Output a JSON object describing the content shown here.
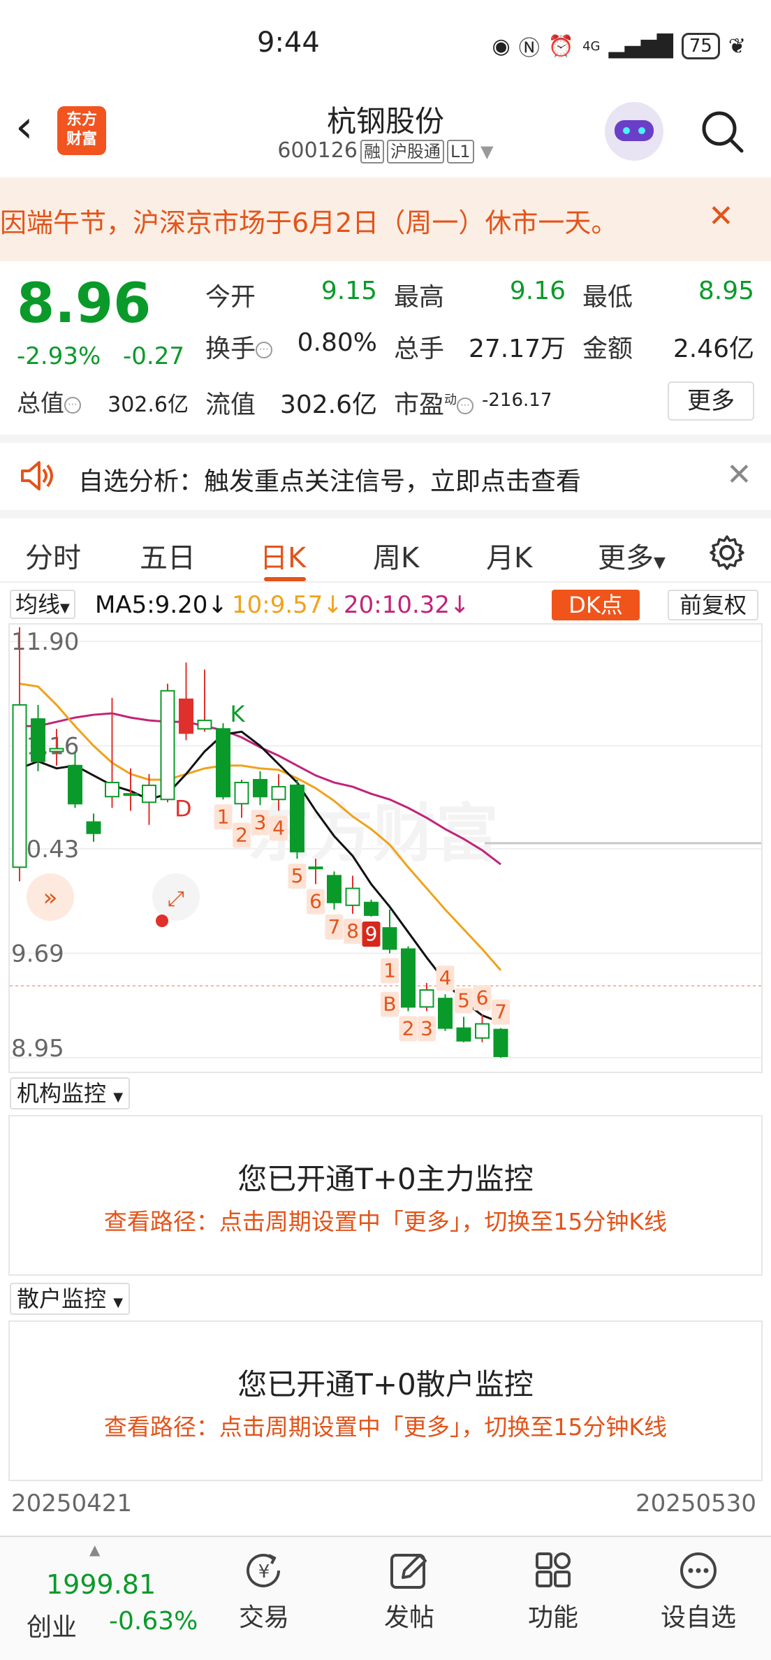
{
  "status_bar": {
    "time": "9:44",
    "battery": "75",
    "network": "4G"
  },
  "header": {
    "logo_line1": "东方",
    "logo_line2": "财富",
    "stock_name": "杭钢股份",
    "stock_code": "600126",
    "tags": [
      "融",
      "沪股通",
      "L1"
    ]
  },
  "notice": {
    "text": "因端午节，沪深京市场于6月2日（周一）休市一天。"
  },
  "quote": {
    "price": "8.96",
    "change_pct": "-2.93%",
    "change_amt": "-0.27",
    "open_label": "今开",
    "open": "9.15",
    "high_label": "最高",
    "high": "9.16",
    "low_label": "最低",
    "low": "8.95",
    "turnover_label": "换手",
    "turnover": "0.80%",
    "volume_label": "总手",
    "volume": "27.17万",
    "amount_label": "金额",
    "amount": "2.46亿",
    "mcap_label": "总值",
    "mcap": "302.6亿",
    "float_label": "流值",
    "float_cap": "302.6亿",
    "pe_label": "市盈",
    "pe_sup": "动",
    "pe": "-216.17",
    "more_label": "更多"
  },
  "analysis": {
    "text": "自选分析：触发重点关注信号，立即点击查看"
  },
  "tabs": [
    "分时",
    "五日",
    "日K",
    "周K",
    "月K",
    "更多"
  ],
  "active_tab": "日K",
  "chart_header": {
    "ma_select": "均线",
    "ma5": "MA5:9.20",
    "ma10": "10:9.57",
    "ma20": "20:10.32",
    "dk": "DK点",
    "adjust": "前复权"
  },
  "colors": {
    "up": "#e0302b",
    "down": "#0a9a2a",
    "accent": "#e2541a",
    "ma5": "#111111",
    "ma10": "#f0a21a",
    "ma20": "#c0247a"
  },
  "chart_data": {
    "type": "candlestick",
    "y_ticks": [
      "11.90",
      "11.16",
      "10.43",
      "9.69",
      "8.95"
    ],
    "ylim": [
      8.95,
      11.9
    ],
    "date_start": "20250421",
    "date_end": "20250530",
    "candles": [
      {
        "o": 10.3,
        "c": 11.45,
        "h": 12.0,
        "l": 10.2
      },
      {
        "o": 11.35,
        "c": 11.05,
        "h": 11.45,
        "l": 10.98
      },
      {
        "o": 11.12,
        "c": 11.14,
        "h": 11.28,
        "l": 11.02
      },
      {
        "o": 11.02,
        "c": 10.75,
        "h": 11.12,
        "l": 10.72
      },
      {
        "o": 10.62,
        "c": 10.54,
        "h": 10.68,
        "l": 10.48
      },
      {
        "o": 10.8,
        "c": 10.9,
        "h": 11.5,
        "l": 10.72
      },
      {
        "o": 10.82,
        "c": 10.82,
        "h": 11.0,
        "l": 10.7
      },
      {
        "o": 10.76,
        "c": 10.88,
        "h": 10.96,
        "l": 10.6
      },
      {
        "o": 10.78,
        "c": 11.55,
        "h": 11.6,
        "l": 10.76
      },
      {
        "o": 11.25,
        "c": 11.49,
        "h": 11.75,
        "l": 11.2
      },
      {
        "o": 11.28,
        "c": 11.34,
        "h": 11.7,
        "l": 11.26
      },
      {
        "o": 11.28,
        "c": 10.8,
        "h": 11.32,
        "l": 10.78
      },
      {
        "o": 10.75,
        "c": 10.9,
        "h": 10.92,
        "l": 10.65
      },
      {
        "o": 10.92,
        "c": 10.8,
        "h": 10.98,
        "l": 10.74
      },
      {
        "o": 10.78,
        "c": 10.87,
        "h": 10.96,
        "l": 10.7
      },
      {
        "o": 10.88,
        "c": 10.41,
        "h": 10.92,
        "l": 10.36
      },
      {
        "o": 10.3,
        "c": 10.3,
        "h": 10.36,
        "l": 10.18
      },
      {
        "o": 10.24,
        "c": 10.05,
        "h": 10.27,
        "l": 10.0
      },
      {
        "o": 10.03,
        "c": 10.15,
        "h": 10.24,
        "l": 9.97
      },
      {
        "o": 10.05,
        "c": 9.96,
        "h": 10.07,
        "l": 9.95
      },
      {
        "o": 9.87,
        "c": 9.72,
        "h": 10.0,
        "l": 9.69
      },
      {
        "o": 9.72,
        "c": 9.31,
        "h": 9.74,
        "l": 9.28
      },
      {
        "o": 9.31,
        "c": 9.43,
        "h": 9.48,
        "l": 9.28
      },
      {
        "o": 9.37,
        "c": 9.16,
        "h": 9.4,
        "l": 9.14
      },
      {
        "o": 9.16,
        "c": 9.07,
        "h": 9.24,
        "l": 9.06
      },
      {
        "o": 9.09,
        "c": 9.19,
        "h": 9.26,
        "l": 9.06
      },
      {
        "o": 9.15,
        "c": 8.96,
        "h": 9.16,
        "l": 8.95
      }
    ],
    "ma5": [
      11.0,
      11.05,
      11.0,
      11.02,
      10.95,
      10.88,
      10.84,
      10.78,
      10.82,
      10.96,
      11.12,
      11.24,
      11.26,
      11.16,
      11.03,
      10.9,
      10.7,
      10.52,
      10.38,
      10.18,
      10.02,
      9.84,
      9.66,
      9.49,
      9.35,
      9.25,
      9.2
    ],
    "ma10": [
      11.6,
      11.58,
      11.45,
      11.3,
      11.16,
      11.04,
      10.96,
      10.92,
      10.92,
      10.96,
      11.0,
      11.02,
      11.02,
      11.0,
      10.99,
      10.93,
      10.86,
      10.77,
      10.66,
      10.57,
      10.46,
      10.3,
      10.15,
      10.0,
      9.86,
      9.72,
      9.57
    ],
    "ma20": [
      11.3,
      11.3,
      11.33,
      11.36,
      11.38,
      11.39,
      11.36,
      11.34,
      11.33,
      11.33,
      11.3,
      11.27,
      11.22,
      11.15,
      11.09,
      11.02,
      10.95,
      10.9,
      10.87,
      10.82,
      10.78,
      10.72,
      10.65,
      10.57,
      10.5,
      10.42,
      10.32
    ],
    "signals": [
      {
        "i": 8,
        "text": "D",
        "pos": "below",
        "color": "#e0302b"
      },
      {
        "i": 11,
        "text": "K",
        "pos": "above",
        "color": "#0a9a2a"
      },
      {
        "i": 11,
        "text": "1",
        "pos": "below",
        "color": "#e2541a"
      },
      {
        "i": 12,
        "text": "2",
        "pos": "below",
        "color": "#e2541a"
      },
      {
        "i": 13,
        "text": "3",
        "pos": "below",
        "color": "#e2541a"
      },
      {
        "i": 14,
        "text": "4",
        "pos": "below",
        "color": "#e2541a"
      },
      {
        "i": 15,
        "text": "5",
        "pos": "below",
        "color": "#e2541a"
      },
      {
        "i": 16,
        "text": "6",
        "pos": "below",
        "color": "#e2541a"
      },
      {
        "i": 17,
        "text": "7",
        "pos": "below",
        "color": "#e2541a"
      },
      {
        "i": 18,
        "text": "8",
        "pos": "below",
        "color": "#e2541a"
      },
      {
        "i": 19,
        "text": "9",
        "pos": "below",
        "color": "#d8271c"
      },
      {
        "i": 20,
        "text": "1",
        "pos": "below",
        "color": "#e2541a"
      },
      {
        "i": 20,
        "text": "B",
        "pos": "below",
        "color": "#e2541a"
      },
      {
        "i": 21,
        "text": "2",
        "pos": "below",
        "color": "#e2541a"
      },
      {
        "i": 22,
        "text": "3",
        "pos": "below",
        "color": "#e2541a"
      },
      {
        "i": 23,
        "text": "4",
        "pos": "above",
        "color": "#e2541a"
      },
      {
        "i": 24,
        "text": "5",
        "pos": "above",
        "color": "#e2541a"
      },
      {
        "i": 25,
        "text": "6",
        "pos": "above",
        "color": "#e2541a"
      },
      {
        "i": 26,
        "text": "7",
        "pos": "above",
        "color": "#e2541a"
      }
    ]
  },
  "monitor_inst": {
    "label": "机构监控",
    "title": "您已开通T+0主力监控",
    "path": "查看路径：点击周期设置中「更多」，切换至15分钟K线"
  },
  "monitor_retail": {
    "label": "散户监控",
    "title": "您已开通T+0散户监控",
    "path": "查看路径：点击周期设置中「更多」，切换至15分钟K线"
  },
  "bottom": {
    "index_value": "1999.81",
    "index_name": "创业",
    "index_change": "-0.63%",
    "nav": [
      "交易",
      "发帖",
      "功能",
      "设自选"
    ]
  }
}
